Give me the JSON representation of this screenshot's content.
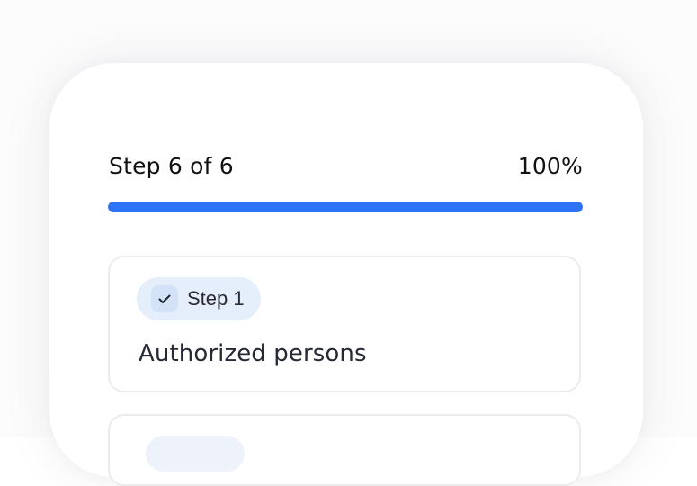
{
  "progress": {
    "step_label": "Step 6 of 6",
    "percent_label": "100%",
    "value": 1.0,
    "fill_color": "#2f73f5"
  },
  "steps": [
    {
      "badge_label": "Step 1",
      "title": "Authorized persons",
      "status_icon": "check-icon"
    }
  ]
}
